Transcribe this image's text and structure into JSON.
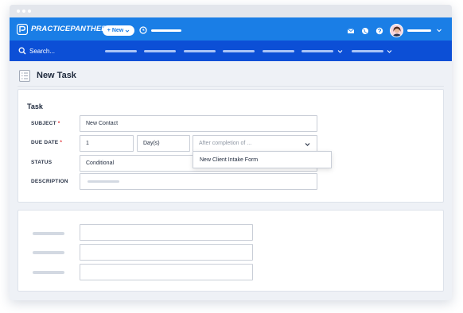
{
  "app": {
    "brand": "PRACTICEPANTHER",
    "brand_mark": "®",
    "new_button": "+ New"
  },
  "nav": {
    "search_placeholder": "Search..."
  },
  "page": {
    "title": "New Task"
  },
  "task_card": {
    "heading": "Task",
    "subject": {
      "label": "SUBJECT",
      "required": "*",
      "value": "New Contact"
    },
    "due_date": {
      "label": "DUE DATE",
      "required": "*",
      "amount": "1",
      "unit": "Day(s)",
      "relation_placeholder": "After completion of ..."
    },
    "status": {
      "label": "STATUS",
      "value": "Conditional"
    },
    "description": {
      "label": "DESCRIPTION"
    }
  },
  "dropdown": {
    "options": [
      "New Client Intake Form"
    ]
  },
  "colors": {
    "topbar": "#1a7ee6",
    "navbar": "#0c4fd6",
    "required": "#e0262b"
  }
}
